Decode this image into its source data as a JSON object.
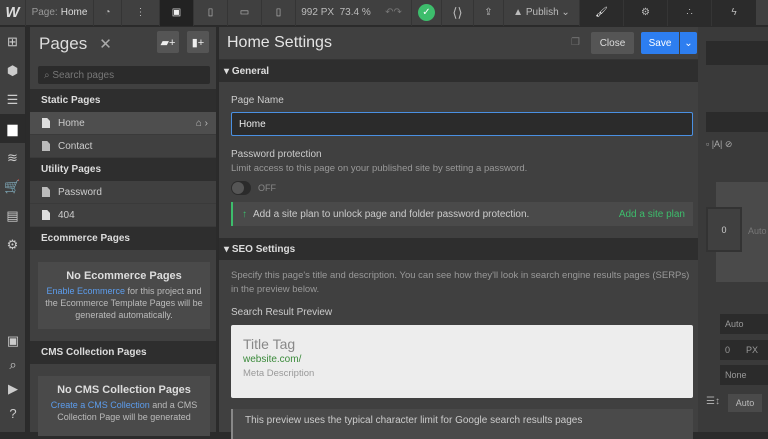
{
  "topbar": {
    "page_label": "Page:",
    "page_name": "Home",
    "width": "992 PX",
    "zoom": "73.4 %",
    "publish": "Publish"
  },
  "pages": {
    "title": "Pages",
    "search_placeholder": "Search pages",
    "static_header": "Static Pages",
    "static": [
      "Home",
      "Contact"
    ],
    "utility_header": "Utility Pages",
    "utility": [
      "Password",
      "404"
    ],
    "ecom_header": "Ecommerce Pages",
    "ecom_empty_title": "No Ecommerce Pages",
    "ecom_link": "Enable Ecommerce",
    "ecom_text": " for this project and the Ecommerce Template Pages will be generated automatically.",
    "cms_header": "CMS Collection Pages",
    "cms_empty_title": "No CMS Collection Pages",
    "cms_link": "Create a CMS Collection",
    "cms_text": " and a CMS Collection Page will be generated"
  },
  "modal": {
    "title": "Home Settings",
    "close": "Close",
    "save": "Save",
    "general": "General",
    "page_name_label": "Page Name",
    "page_name_value": "Home",
    "password_label": "Password protection",
    "password_desc": "Limit access to this page on your published site by setting a password.",
    "toggle": "OFF",
    "plan_msg": "Add a site plan to unlock page and folder password protection.",
    "plan_link": "Add a site plan",
    "seo": "SEO Settings",
    "seo_desc": "Specify this page's title and description. You can see how they'll look in search engine results pages (SERPs) in the preview below.",
    "preview_label": "Search Result Preview",
    "preview_title": "Title Tag",
    "preview_url": "website.com/",
    "preview_meta": "Meta Description",
    "note": "This preview uses the typical character limit for Google search results pages"
  },
  "right": {
    "v0": "0",
    "auto": "Auto",
    "auto2": "Auto",
    "zero": "0",
    "px": "PX",
    "none": "None",
    "auto3": "Auto"
  }
}
